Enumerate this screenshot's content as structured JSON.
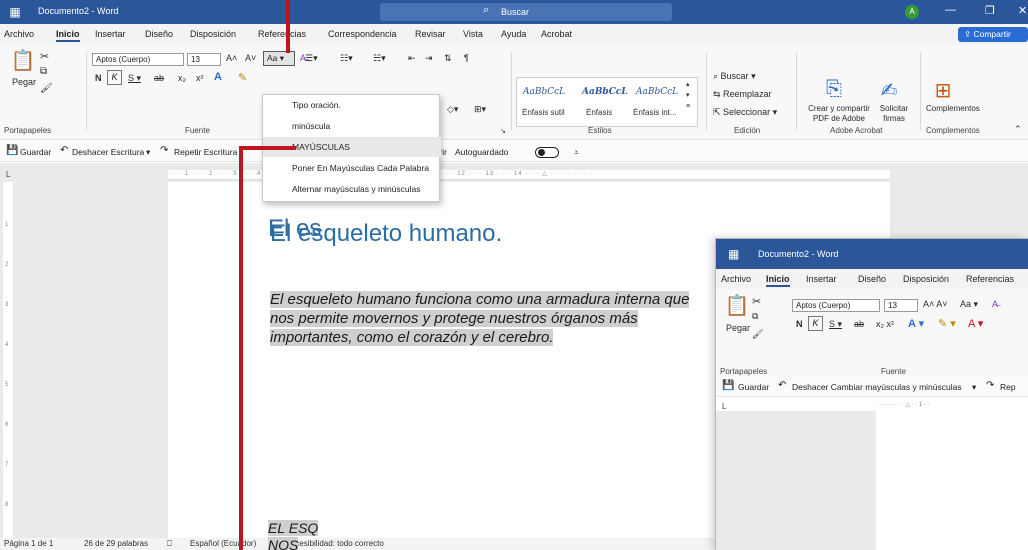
{
  "colors": {
    "word_blue": "#2b579a",
    "accent_red": "#c0151c",
    "heading_blue": "#2b6ca3"
  },
  "titlebar": {
    "doc_title": "Documento2 - Word",
    "search_placeholder": "Buscar",
    "avatar_initial": "A"
  },
  "tabs": [
    "Archivo",
    "Inicio",
    "Insertar",
    "Diseño",
    "Disposición",
    "Referencias",
    "Correspondencia",
    "Revisar",
    "Vista",
    "Ayuda",
    "Acrobat"
  ],
  "share_label": "Compartir",
  "ribbon": {
    "clipboard": {
      "paste": "Pegar",
      "label": "Portapapeles"
    },
    "font": {
      "name": "Aptos (Cuerpo)",
      "size": "13",
      "change_case": "Aa",
      "label": "Fuente"
    },
    "styles": {
      "samples": [
        "AaBbCcL",
        "AaBbCcL",
        "AaBbCcL"
      ],
      "names": [
        "Énfasis sutil",
        "Énfasis",
        "Énfasis int..."
      ],
      "label": "Estilos"
    },
    "editing": {
      "find": "Buscar",
      "replace": "Reemplazar",
      "select": "Seleccionar",
      "label": "Edición"
    },
    "acrobat": {
      "create_share": "Crear y compartir PDF de Adobe",
      "request_sign": "Solicitar firmas",
      "label": "Adobe Acrobat"
    },
    "addins": {
      "addins": "Complementos",
      "label": "Complementos"
    }
  },
  "qat": {
    "save": "Guardar",
    "undo": "Deshacer Escritura",
    "redo": "Repetir Escritura",
    "open": "Abrir",
    "autosave": "Autoguardado"
  },
  "change_case_menu": [
    "Tipo oración.",
    "minúscula",
    "MAYÚSCULAS",
    "Poner En Mayúsculas Cada Palabra",
    "Alternar mayúsculas y minúsculas"
  ],
  "document": {
    "heading": "El esqueleto humano.",
    "paragraph": "El esqueleto humano funciona como una armadura interna que nos permite movernos y protege nuestros órganos más importantes, como el corazón y el cerebro."
  },
  "status": {
    "page": "Página 1 de 1",
    "words": "26 de 29 palabras",
    "language": "Español (Ecuador)",
    "accessibility": "Accesibilidad: todo correcto"
  },
  "window2": {
    "doc_title": "Documento2 - Word",
    "tabs": [
      "Archivo",
      "Inicio",
      "Insertar",
      "Diseño",
      "Disposición",
      "Referencias"
    ],
    "font_name": "Aptos (Cuerpo)",
    "font_size": "13",
    "paste": "Pegar",
    "clipboard_label": "Portapapeles",
    "font_label": "Fuente",
    "save": "Guardar",
    "undo": "Deshacer Cambiar mayúsculas y minúsculas",
    "redo": "Rep",
    "heading_partial": "El es",
    "para_line1": "EL ESQ",
    "para_line2": "NOS"
  }
}
